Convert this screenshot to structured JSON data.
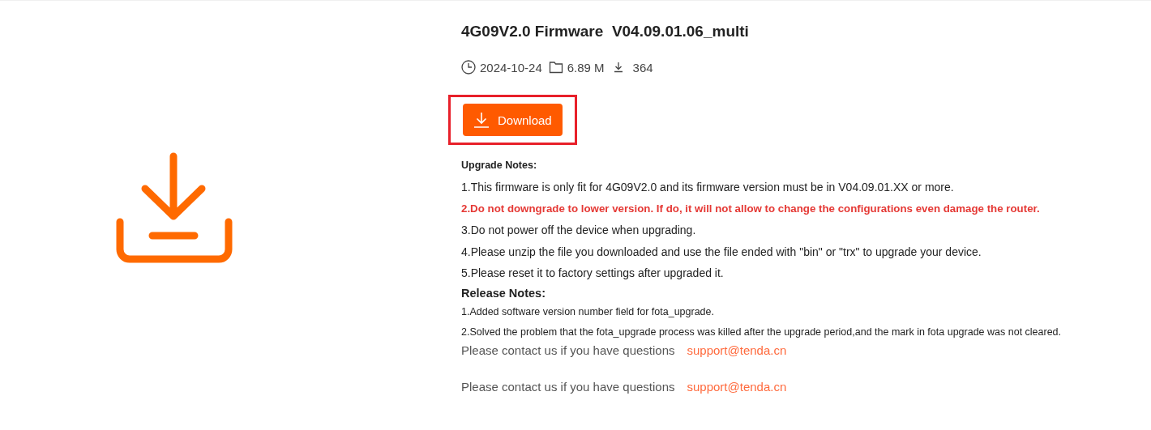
{
  "title": "4G09V2.0 Firmware  V04.09.01.06_multi",
  "meta": {
    "date": "2024-10-24",
    "size": "6.89 M",
    "downloads": "364"
  },
  "download_button": {
    "label": "Download",
    "highlighted": true
  },
  "upgrade_notes": {
    "heading": "Upgrade Notes:",
    "items": [
      {
        "kind": "normal",
        "text": "1.This firmware is only fit for 4G09V2.0 and its firmware version must be in V04.09.01.XX or more."
      },
      {
        "kind": "warning",
        "text": "2.Do not downgrade to lower version. If do, it will not allow to change the configurations even damage the router."
      },
      {
        "kind": "normal",
        "text": "3.Do not power off the device when upgrading."
      },
      {
        "kind": "normal",
        "text": "4.Please unzip the file you downloaded and use the file ended with \"bin\" or \"trx\" to upgrade your device."
      },
      {
        "kind": "normal",
        "text": "5.Please reset it to factory settings after upgraded it."
      }
    ]
  },
  "release_notes": {
    "heading": "Release Notes:",
    "items": [
      "1.Added software version number field for fota_upgrade.",
      "2.Solved the problem that the fota_upgrade process was killed after the upgrade period,and the mark in fota upgrade was not cleared."
    ]
  },
  "contacts": [
    {
      "text": "Please contact us if you have questions",
      "email": "support@tenda.cn"
    },
    {
      "text": "Please contact us if you have questions",
      "email": "support@tenda.cn"
    }
  ]
}
